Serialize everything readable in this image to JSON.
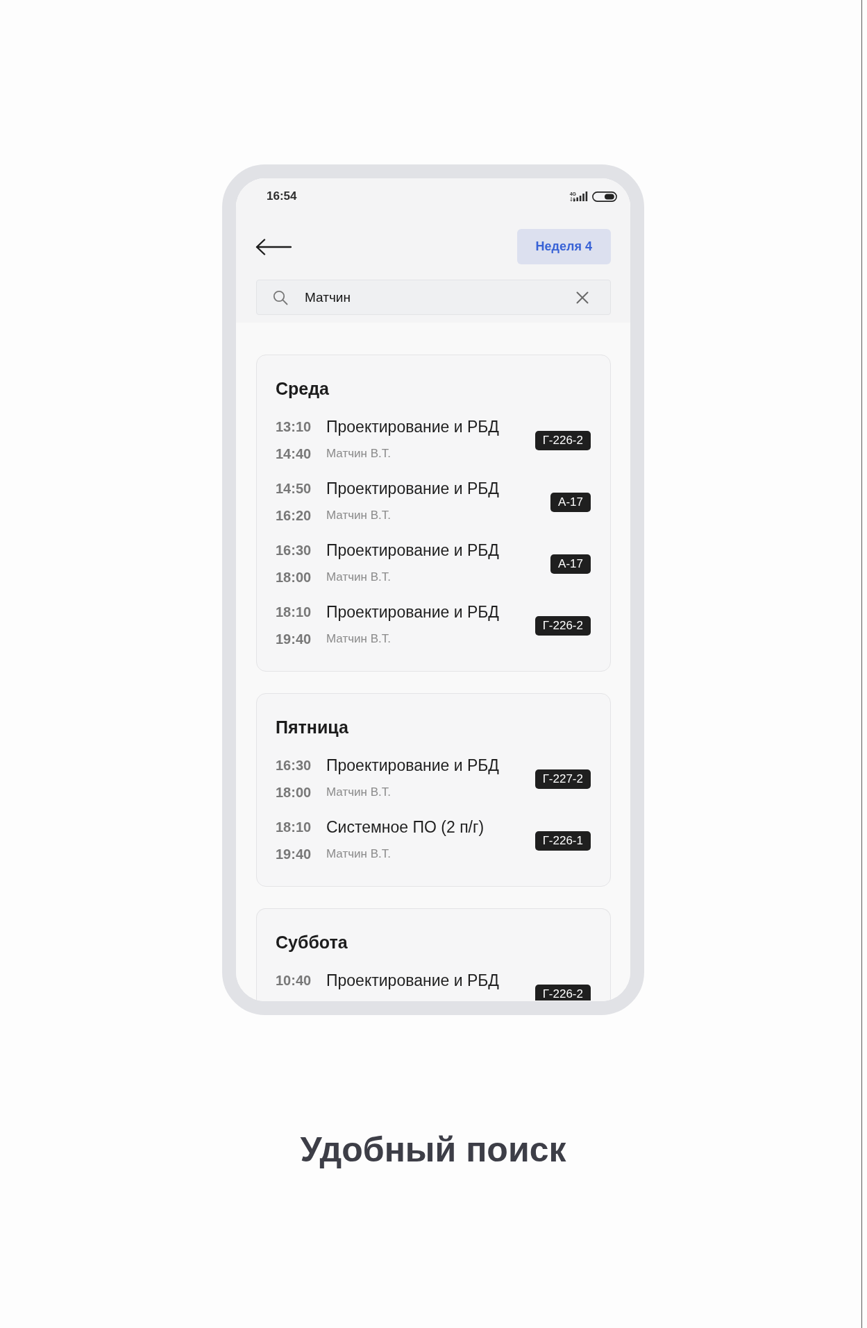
{
  "status_bar": {
    "time": "16:54",
    "network": "4G"
  },
  "header": {
    "week_button": "Неделя 4"
  },
  "search": {
    "value": "Матчин"
  },
  "days": [
    {
      "title": "Среда",
      "lessons": [
        {
          "start": "13:10",
          "end": "14:40",
          "subject": "Проектирование и РБД",
          "teacher": "Матчин В.Т.",
          "room": "Г-226-2"
        },
        {
          "start": "14:50",
          "end": "16:20",
          "subject": "Проектирование и РБД",
          "teacher": "Матчин В.Т.",
          "room": "А-17"
        },
        {
          "start": "16:30",
          "end": "18:00",
          "subject": "Проектирование и РБД",
          "teacher": "Матчин В.Т.",
          "room": "А-17"
        },
        {
          "start": "18:10",
          "end": "19:40",
          "subject": "Проектирование и РБД",
          "teacher": "Матчин В.Т.",
          "room": "Г-226-2"
        }
      ]
    },
    {
      "title": "Пятница",
      "lessons": [
        {
          "start": "16:30",
          "end": "18:00",
          "subject": "Проектирование и РБД",
          "teacher": "Матчин В.Т.",
          "room": "Г-227-2"
        },
        {
          "start": "18:10",
          "end": "19:40",
          "subject": "Системное ПО (2 п/г)",
          "teacher": "Матчин В.Т.",
          "room": "Г-226-1"
        }
      ]
    },
    {
      "title": "Суббота",
      "lessons": [
        {
          "start": "10:40",
          "subject": "Проектирование и РБД",
          "room": "Г-226-2"
        }
      ]
    }
  ],
  "caption": "Удобный поиск"
}
